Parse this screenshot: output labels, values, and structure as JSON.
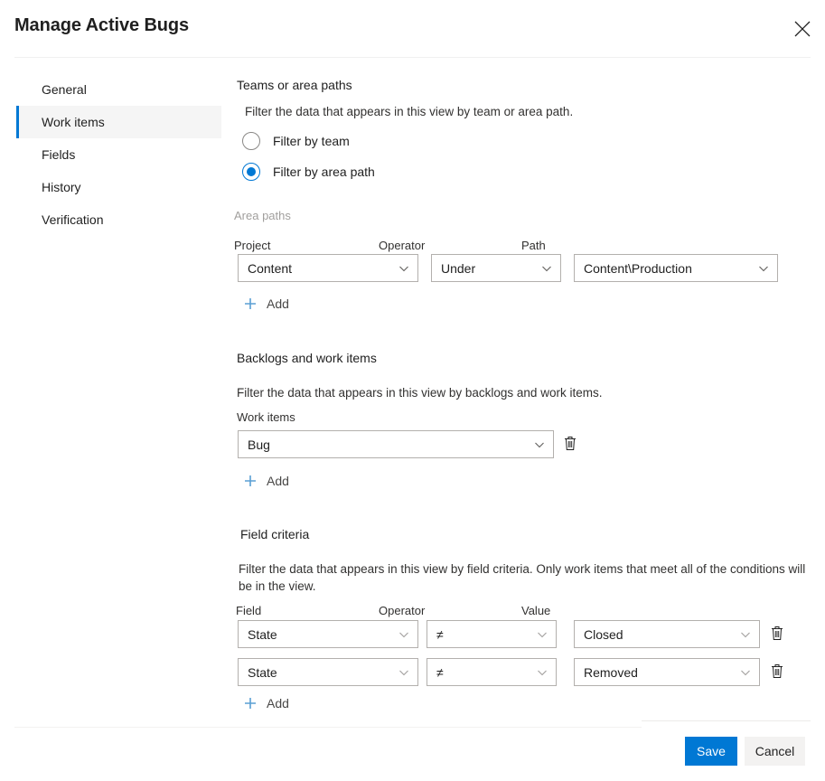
{
  "header": {
    "title": "Manage Active Bugs",
    "close_icon": "close-icon"
  },
  "sidebar": {
    "items": [
      {
        "label": "General",
        "selected": false
      },
      {
        "label": "Work items",
        "selected": true
      },
      {
        "label": "Fields",
        "selected": false
      },
      {
        "label": "History",
        "selected": false
      },
      {
        "label": "Verification",
        "selected": false
      }
    ]
  },
  "sections": {
    "teams_or_area_paths": {
      "heading": "Teams or area paths",
      "description": "Filter the data that appears in this view by team or area path.",
      "radios": [
        {
          "label": "Filter by team",
          "checked": false
        },
        {
          "label": "Filter by area path",
          "checked": true
        }
      ]
    },
    "area_paths": {
      "group_label": "Area paths",
      "column_headers": {
        "project": "Project",
        "operator": "Operator",
        "path": "Path"
      },
      "rows": [
        {
          "project": "Content",
          "operator": "Under",
          "path": "Content\\Production"
        }
      ],
      "add_label": "Add"
    },
    "backlogs_and_work_items": {
      "heading": "Backlogs and work items",
      "description": "Filter the data that appears in this view by backlogs and work items.",
      "column_header": "Work items",
      "rows": [
        {
          "value": "Bug"
        }
      ],
      "add_label": "Add",
      "delete_icon": "trash-icon"
    },
    "field_criteria": {
      "heading": "Field criteria",
      "description": "Filter the data that appears in this view by field criteria. Only work items that meet all of the conditions will be in the view.",
      "column_headers": {
        "field": "Field",
        "operator": "Operator",
        "value": "Value"
      },
      "rows": [
        {
          "field": "State",
          "operator": "≠",
          "value": "Closed"
        },
        {
          "field": "State",
          "operator": "≠",
          "value": "Removed"
        }
      ],
      "add_label": "Add",
      "delete_icon": "trash-icon"
    }
  },
  "footer": {
    "save_label": "Save",
    "cancel_label": "Cancel"
  },
  "colors": {
    "accent": "#0078d4",
    "primary_button_bg": "#0078d4",
    "secondary_button_bg": "#f3f2f1",
    "selected_nav_bg": "#f5f5f5",
    "border": "#b3b0ad",
    "muted_label": "#a19f9d"
  }
}
